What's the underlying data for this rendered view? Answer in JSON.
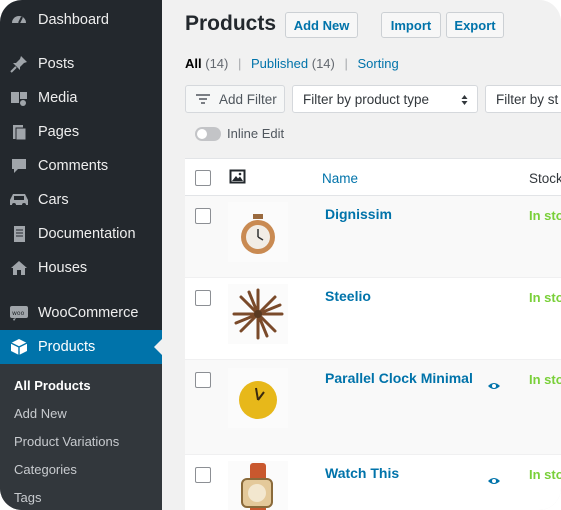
{
  "sidebar": {
    "menu": [
      {
        "label": "Dashboard",
        "icon": "dashboard-icon"
      },
      {
        "label": "Posts",
        "icon": "pin-icon"
      },
      {
        "label": "Media",
        "icon": "media-icon"
      },
      {
        "label": "Pages",
        "icon": "pages-icon"
      },
      {
        "label": "Comments",
        "icon": "comment-icon"
      },
      {
        "label": "Cars",
        "icon": "car-icon"
      },
      {
        "label": "Documentation",
        "icon": "document-icon"
      },
      {
        "label": "Houses",
        "icon": "house-icon"
      },
      {
        "label": "WooCommerce",
        "icon": "woocommerce-icon"
      },
      {
        "label": "Products",
        "icon": "box-icon"
      }
    ],
    "submenu": [
      "All Products",
      "Add New",
      "Product Variations",
      "Categories",
      "Tags"
    ]
  },
  "header": {
    "title": "Products",
    "add_new": "Add New",
    "import": "Import",
    "export": "Export"
  },
  "filters": {
    "all": "All",
    "all_count": "(14)",
    "published": "Published",
    "published_count": "(14)",
    "sorting": "Sorting",
    "sep": "|",
    "add_filter": "Add Filter",
    "product_type": "Filter by product type",
    "stock_status": "Filter by st",
    "inline_edit": "Inline Edit"
  },
  "table": {
    "col_name": "Name",
    "col_stock": "Stock",
    "rows": [
      {
        "name": "Dignissim",
        "stock": "In sto"
      },
      {
        "name": "Steelio",
        "stock": "In sto"
      },
      {
        "name": "Parallel Clock Minimal",
        "stock": "In sto"
      },
      {
        "name": "Watch This",
        "stock": "In sto"
      }
    ]
  },
  "colors": {
    "sidebar": "#23282d",
    "submenu": "#32373c",
    "accent": "#0073aa",
    "in_stock": "#7ad03a"
  }
}
